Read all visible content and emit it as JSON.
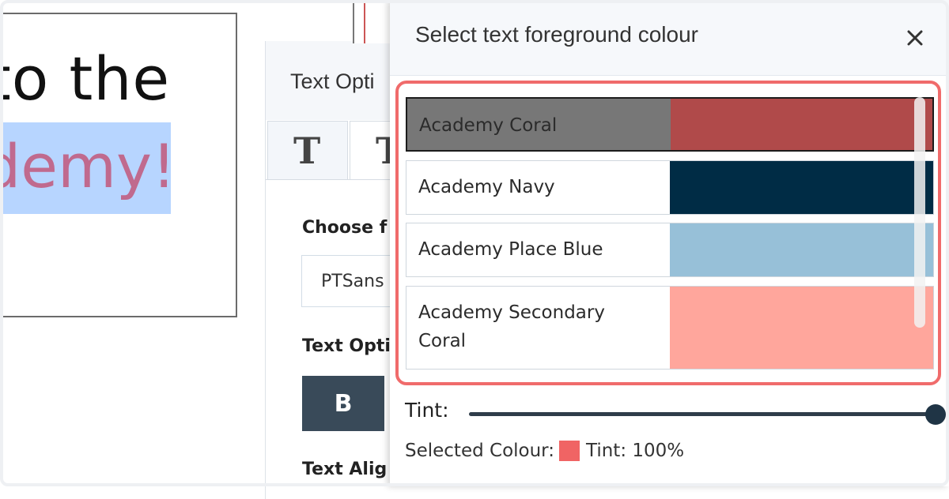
{
  "canvas": {
    "line1": "to the",
    "line2": "demy!"
  },
  "text_panel": {
    "title": "Text Opti",
    "tabs": [
      {
        "glyph": "T"
      },
      {
        "glyph": "T"
      }
    ],
    "choose_font_label": "Choose f",
    "font_value": "PTSans",
    "text_options_label": "Text Opti",
    "bold_label": "B",
    "text_align_label": "Text Alig"
  },
  "popup": {
    "title": "Select text foreground colour",
    "close_label": "×",
    "swatches": [
      {
        "name": "Academy Coral",
        "color": "#b04a4a",
        "selected": true
      },
      {
        "name": "Academy Navy",
        "color": "#002c45",
        "selected": false
      },
      {
        "name": "Academy Place Blue",
        "color": "#97c0d8",
        "selected": false
      },
      {
        "name": "Academy Secondary Coral",
        "color": "#ffa69c",
        "selected": false
      }
    ],
    "tint": {
      "label": "Tint:",
      "value": 100
    },
    "selected_colour": {
      "label": "Selected Colour:",
      "color": "#f06464",
      "tint_text": "Tint: 100%"
    }
  }
}
